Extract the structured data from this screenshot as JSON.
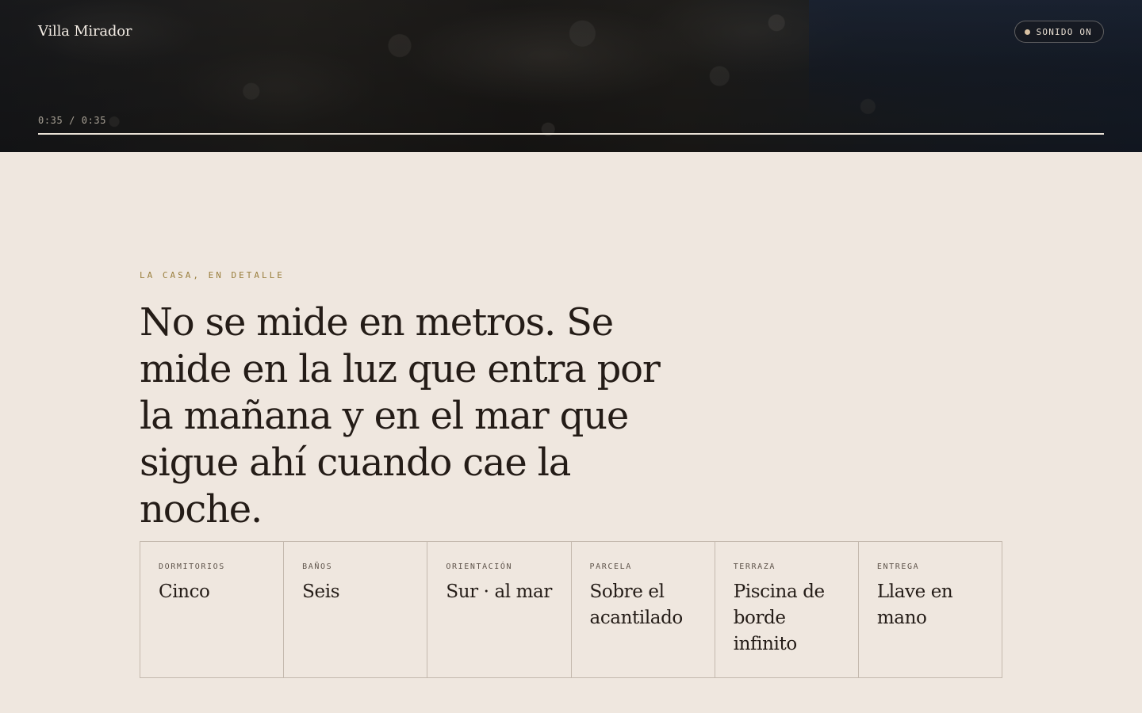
{
  "header": {
    "brand": "Villa Mirador",
    "sound_toggle_label": "SONIDO ON"
  },
  "video": {
    "time_readout": "0:35 / 0:35",
    "progress": 1.0
  },
  "detail": {
    "eyebrow": "LA CASA, EN DETALLE",
    "headline": "No se mide en metros. Se mide en la luz que entra por la mañana y en el mar que sigue ahí cuando cae la noche.",
    "specs": [
      {
        "label": "DORMITORIOS",
        "value": "Cinco"
      },
      {
        "label": "BAÑOS",
        "value": "Seis"
      },
      {
        "label": "ORIENTACIÓN",
        "value": "Sur · al mar"
      },
      {
        "label": "PARCELA",
        "value": "Sobre el acantilado"
      },
      {
        "label": "TERRAZA",
        "value": "Piscina de borde infinito"
      },
      {
        "label": "ENTREGA",
        "value": "Llave en mano"
      }
    ]
  }
}
